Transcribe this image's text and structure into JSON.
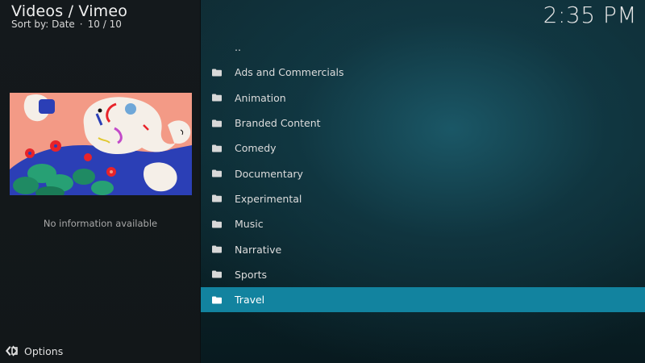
{
  "header": {
    "title": "Videos / Vimeo",
    "sort_label": "Sort by: Date",
    "separator": "·",
    "count": "10 / 10"
  },
  "clock": "2:35 PM",
  "info_panel": {
    "no_info_text": "No information available"
  },
  "footer": {
    "options_label": "Options"
  },
  "list": {
    "items": [
      {
        "label": "..",
        "icon": "none",
        "selected": false
      },
      {
        "label": "Ads and Commercials",
        "icon": "folder-icon",
        "selected": false
      },
      {
        "label": "Animation",
        "icon": "folder-icon",
        "selected": false
      },
      {
        "label": "Branded Content",
        "icon": "folder-icon",
        "selected": false
      },
      {
        "label": "Comedy",
        "icon": "folder-icon",
        "selected": false
      },
      {
        "label": "Documentary",
        "icon": "folder-icon",
        "selected": false
      },
      {
        "label": "Experimental",
        "icon": "folder-icon",
        "selected": false
      },
      {
        "label": "Music",
        "icon": "folder-icon",
        "selected": false
      },
      {
        "label": "Narrative",
        "icon": "folder-icon",
        "selected": false
      },
      {
        "label": "Sports",
        "icon": "folder-icon",
        "selected": false
      },
      {
        "label": "Travel",
        "icon": "folder-icon",
        "selected": true
      }
    ]
  },
  "colors": {
    "selected_row": "#12839f",
    "left_panel": "#14191c",
    "background": "#0f2b33"
  }
}
